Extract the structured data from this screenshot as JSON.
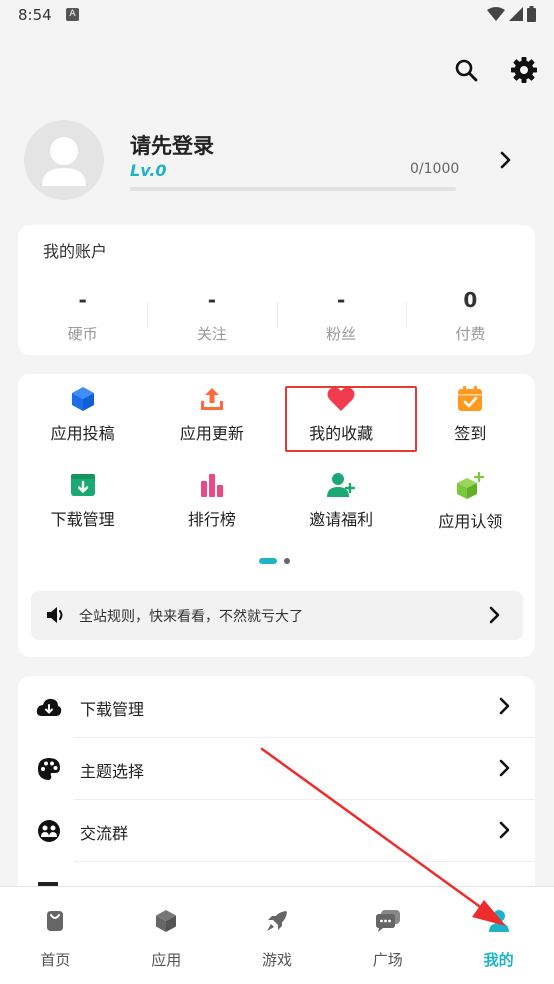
{
  "status_bar": {
    "time": "8:54",
    "a_label": "A"
  },
  "profile": {
    "name": "请先登录",
    "level": "Lv.0",
    "progress_text": "0/1000",
    "progress_fraction": 0
  },
  "account": {
    "title": "我的账户",
    "stats": [
      {
        "value": "-",
        "label": "硬币"
      },
      {
        "value": "-",
        "label": "关注"
      },
      {
        "value": "-",
        "label": "粉丝"
      },
      {
        "value": "0",
        "label": "付费"
      }
    ]
  },
  "shortcuts": [
    {
      "label": "应用投稿",
      "icon": "cube-icon"
    },
    {
      "label": "应用更新",
      "icon": "upload-icon"
    },
    {
      "label": "我的收藏",
      "icon": "heart-icon"
    },
    {
      "label": "签到",
      "icon": "calendar-check-icon"
    },
    {
      "label": "下载管理",
      "icon": "download-box-icon"
    },
    {
      "label": "排行榜",
      "icon": "bar-chart-icon"
    },
    {
      "label": "邀请福利",
      "icon": "add-user-icon"
    },
    {
      "label": "应用认领",
      "icon": "cube-plus-icon"
    }
  ],
  "notice": {
    "text": "全站规则，快来看看，不然就亏大了"
  },
  "menu": [
    {
      "label": "下载管理",
      "icon": "cloud-download-icon"
    },
    {
      "label": "主题选择",
      "icon": "palette-icon"
    },
    {
      "label": "交流群",
      "icon": "group-icon"
    }
  ],
  "bottom_nav": [
    {
      "label": "首页",
      "icon": "bag-icon"
    },
    {
      "label": "应用",
      "icon": "cube-icon"
    },
    {
      "label": "游戏",
      "icon": "rocket-icon"
    },
    {
      "label": "广场",
      "icon": "chat-icon"
    },
    {
      "label": "我的",
      "icon": "person-icon",
      "active": true
    }
  ],
  "colors": {
    "accent": "#1fb3c6",
    "highlight_red": "#e53935",
    "blue": "#1976f0",
    "orange": "#ff6a3d",
    "red": "#f23c4d",
    "amber": "#ff9a1f",
    "green": "#1aa874",
    "pink": "#e94a86",
    "lime": "#7ac93a"
  }
}
